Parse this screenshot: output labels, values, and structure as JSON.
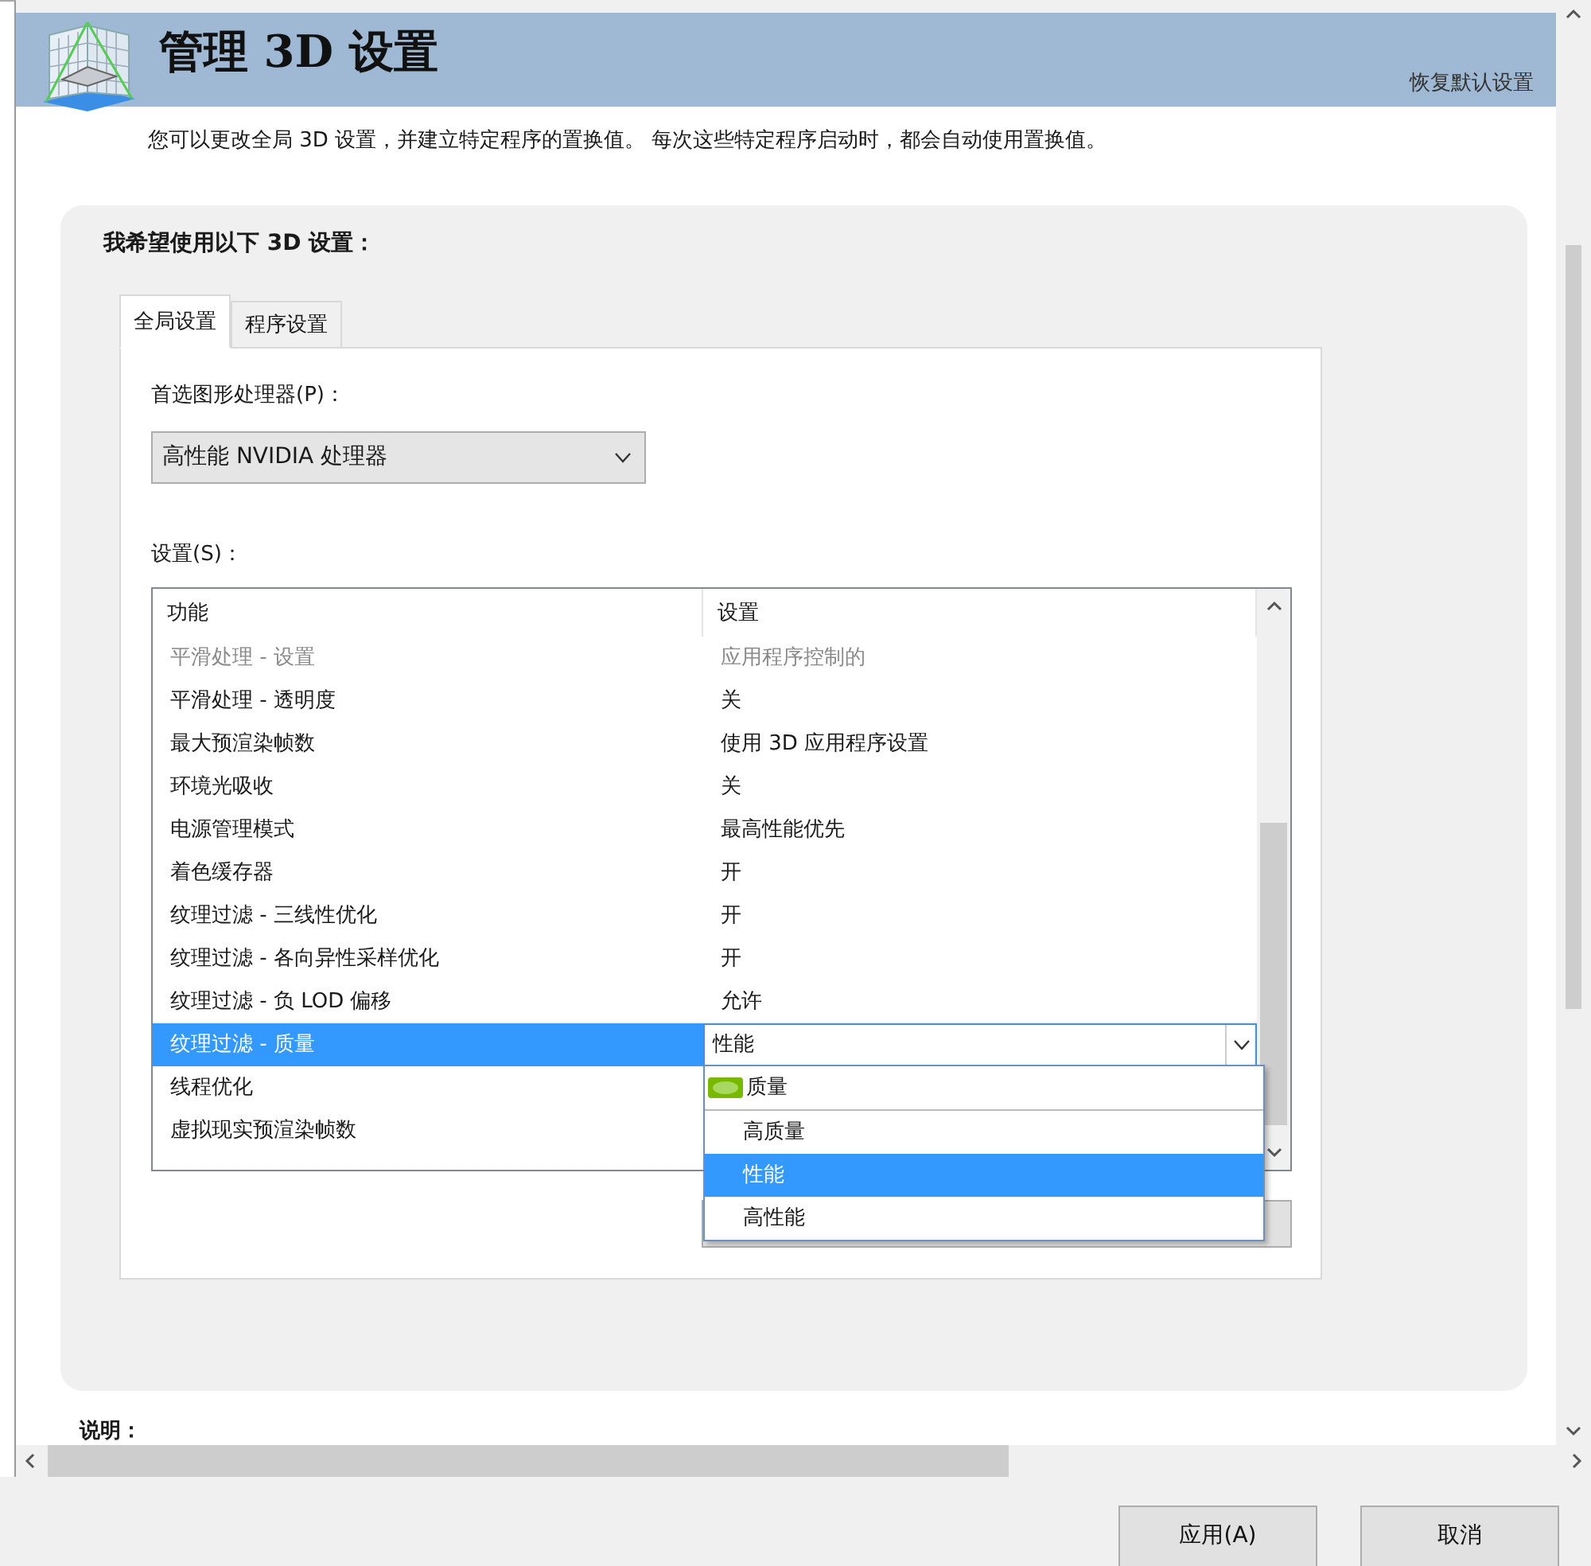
{
  "header": {
    "title": "管理 3D 设置",
    "restore_link": "恢复默认设置"
  },
  "description": "您可以更改全局 3D 设置，并建立特定程序的置换值。 每次这些特定程序启动时，都会自动使用置换值。",
  "settings_card": {
    "heading": "我希望使用以下 3D 设置：",
    "tabs": [
      {
        "label": "全局设置",
        "selected": true
      },
      {
        "label": "程序设置",
        "selected": false
      }
    ],
    "processor": {
      "label": "首选图形处理器(P)：",
      "value": "高性能 NVIDIA 处理器"
    },
    "settings_label": "设置(S)：",
    "table": {
      "columns": [
        "功能",
        "设置"
      ],
      "rows": [
        {
          "feature": "平滑处理 - 设置",
          "setting": "应用程序控制的",
          "disabled": true,
          "selected": false
        },
        {
          "feature": "平滑处理 - 透明度",
          "setting": "关",
          "disabled": false,
          "selected": false
        },
        {
          "feature": "最大预渲染帧数",
          "setting": "使用 3D 应用程序设置",
          "disabled": false,
          "selected": false
        },
        {
          "feature": "环境光吸收",
          "setting": "关",
          "disabled": false,
          "selected": false
        },
        {
          "feature": "电源管理模式",
          "setting": "最高性能优先",
          "disabled": false,
          "selected": false
        },
        {
          "feature": "着色缓存器",
          "setting": "开",
          "disabled": false,
          "selected": false
        },
        {
          "feature": "纹理过滤 - 三线性优化",
          "setting": "开",
          "disabled": false,
          "selected": false
        },
        {
          "feature": "纹理过滤 - 各向异性采样优化",
          "setting": "开",
          "disabled": false,
          "selected": false
        },
        {
          "feature": "纹理过滤 - 负 LOD 偏移",
          "setting": "允许",
          "disabled": false,
          "selected": false
        },
        {
          "feature": "纹理过滤 - 质量",
          "setting": "性能",
          "disabled": false,
          "selected": true
        },
        {
          "feature": "线程优化",
          "disabled": false,
          "selected": false
        },
        {
          "feature": "虚拟现实预渲染帧数",
          "disabled": false,
          "selected": false
        }
      ]
    },
    "dropdown": {
      "options": [
        {
          "label": "质量",
          "default": true,
          "selected": false
        },
        {
          "label": "高质量",
          "default": false,
          "selected": false
        },
        {
          "label": "性能",
          "default": false,
          "selected": true
        },
        {
          "label": "高性能",
          "default": false,
          "selected": false
        }
      ]
    }
  },
  "notes_label": "说明：",
  "buttons": [
    {
      "label": "应用(A)"
    },
    {
      "label": "取消"
    }
  ]
}
